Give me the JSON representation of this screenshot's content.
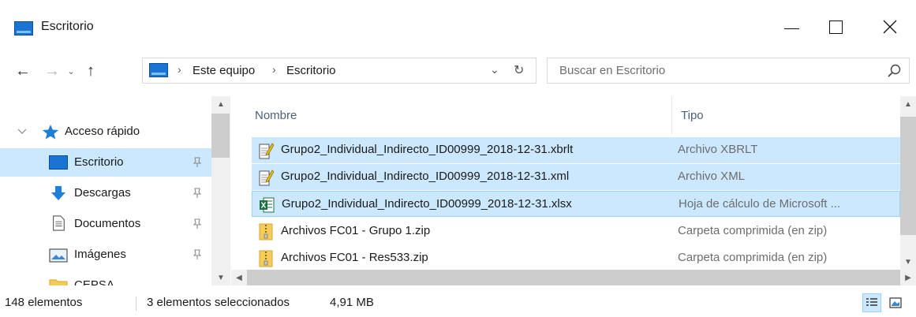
{
  "window": {
    "title": "Escritorio",
    "minimize_label": "—",
    "maximize_label": "",
    "close_label": "✕"
  },
  "nav": {
    "back": "←",
    "forward": "→",
    "recent": "⌄",
    "up": "↑"
  },
  "address": {
    "sep": "›",
    "crumbs": [
      "Este equipo",
      "Escritorio"
    ],
    "dropdown": "⌄",
    "refresh": "↻"
  },
  "search": {
    "placeholder": "Buscar en Escritorio"
  },
  "sidebar": {
    "items": [
      {
        "label": "Acceso rápido",
        "icon": "star-icon"
      },
      {
        "label": "Escritorio",
        "icon": "desktop-icon",
        "pinned": true,
        "selected": true
      },
      {
        "label": "Descargas",
        "icon": "download-icon",
        "pinned": true
      },
      {
        "label": "Documentos",
        "icon": "document-icon",
        "pinned": true
      },
      {
        "label": "Imágenes",
        "icon": "pictures-icon",
        "pinned": true
      },
      {
        "label": "CEPSA",
        "icon": "folder-icon"
      }
    ]
  },
  "files": {
    "columns": {
      "name": "Nombre",
      "type": "Tipo"
    },
    "rows": [
      {
        "name": "Grupo2_Individual_Indirecto_ID00999_2018-12-31.xbrlt",
        "type": "Archivo XBRLT",
        "icon": "text-file-icon",
        "selected": true
      },
      {
        "name": "Grupo2_Individual_Indirecto_ID00999_2018-12-31.xml",
        "type": "Archivo XML",
        "icon": "text-file-icon",
        "selected": true
      },
      {
        "name": "Grupo2_Individual_Indirecto_ID00999_2018-12-31.xlsx",
        "type": "Hoja de cálculo de Microsoft ...",
        "icon": "excel-file-icon",
        "selected": true,
        "focused": true
      },
      {
        "name": "Archivos FC01 - Grupo 1.zip",
        "type": "Carpeta comprimida (en zip)",
        "icon": "zip-folder-icon"
      },
      {
        "name": "Archivos FC01 - Res533.zip",
        "type": "Carpeta comprimida (en zip)",
        "icon": "zip-folder-icon"
      }
    ]
  },
  "status": {
    "count": "148 elementos",
    "selected": "3 elementos seleccionados",
    "size": "4,91 MB"
  },
  "colors": {
    "selection": "#cce8ff",
    "selection_border": "#99d1ff",
    "accent": "#1a74d2"
  }
}
